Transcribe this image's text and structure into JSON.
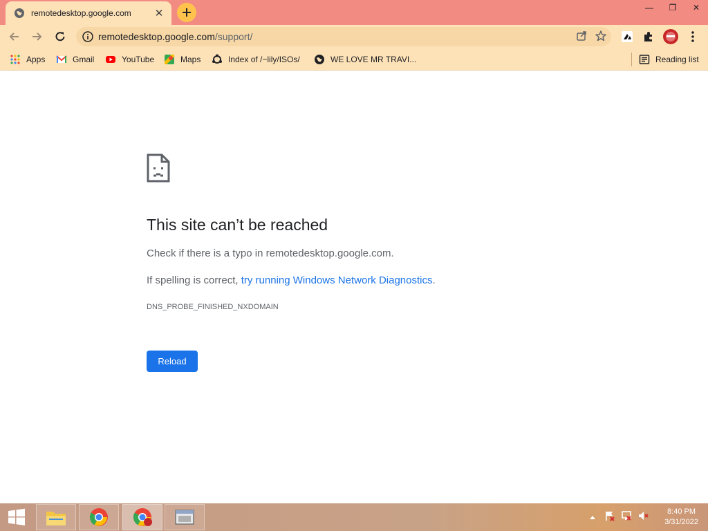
{
  "tab": {
    "title": "remotedesktop.google.com",
    "close_glyph": "✕"
  },
  "window": {
    "minimize_glyph": "—",
    "restore_glyph": "❐",
    "close_glyph": "✕"
  },
  "omnibox": {
    "host": "remotedesktop.google.com",
    "path": "/support/"
  },
  "bookmarks": [
    {
      "label": "Apps",
      "icon": "apps-grid-icon"
    },
    {
      "label": "Gmail",
      "icon": "gmail-icon"
    },
    {
      "label": "YouTube",
      "icon": "youtube-icon"
    },
    {
      "label": "Maps",
      "icon": "maps-icon"
    },
    {
      "label": "Index of /~lily/ISOs/",
      "icon": "ubuntu-icon"
    },
    {
      "label": "WE LOVE MR TRAVI...",
      "icon": "globe-icon"
    }
  ],
  "reading_list": "Reading list",
  "error": {
    "title": "This site can’t be reached",
    "line1": "Check if there is a typo in remotedesktop.google.com.",
    "line2_prefix": "If spelling is correct, ",
    "line2_link": "try running Windows Network Diagnostics",
    "line2_suffix": ".",
    "code": "DNS_PROBE_FINISHED_NXDOMAIN",
    "reload_label": "Reload"
  },
  "taskbar": {
    "time": "8:40 PM",
    "date": "3/31/2022"
  },
  "colors": {
    "titlebar": "#f28b82",
    "toolbar": "#fde2b8",
    "accent": "#1a73e8"
  }
}
